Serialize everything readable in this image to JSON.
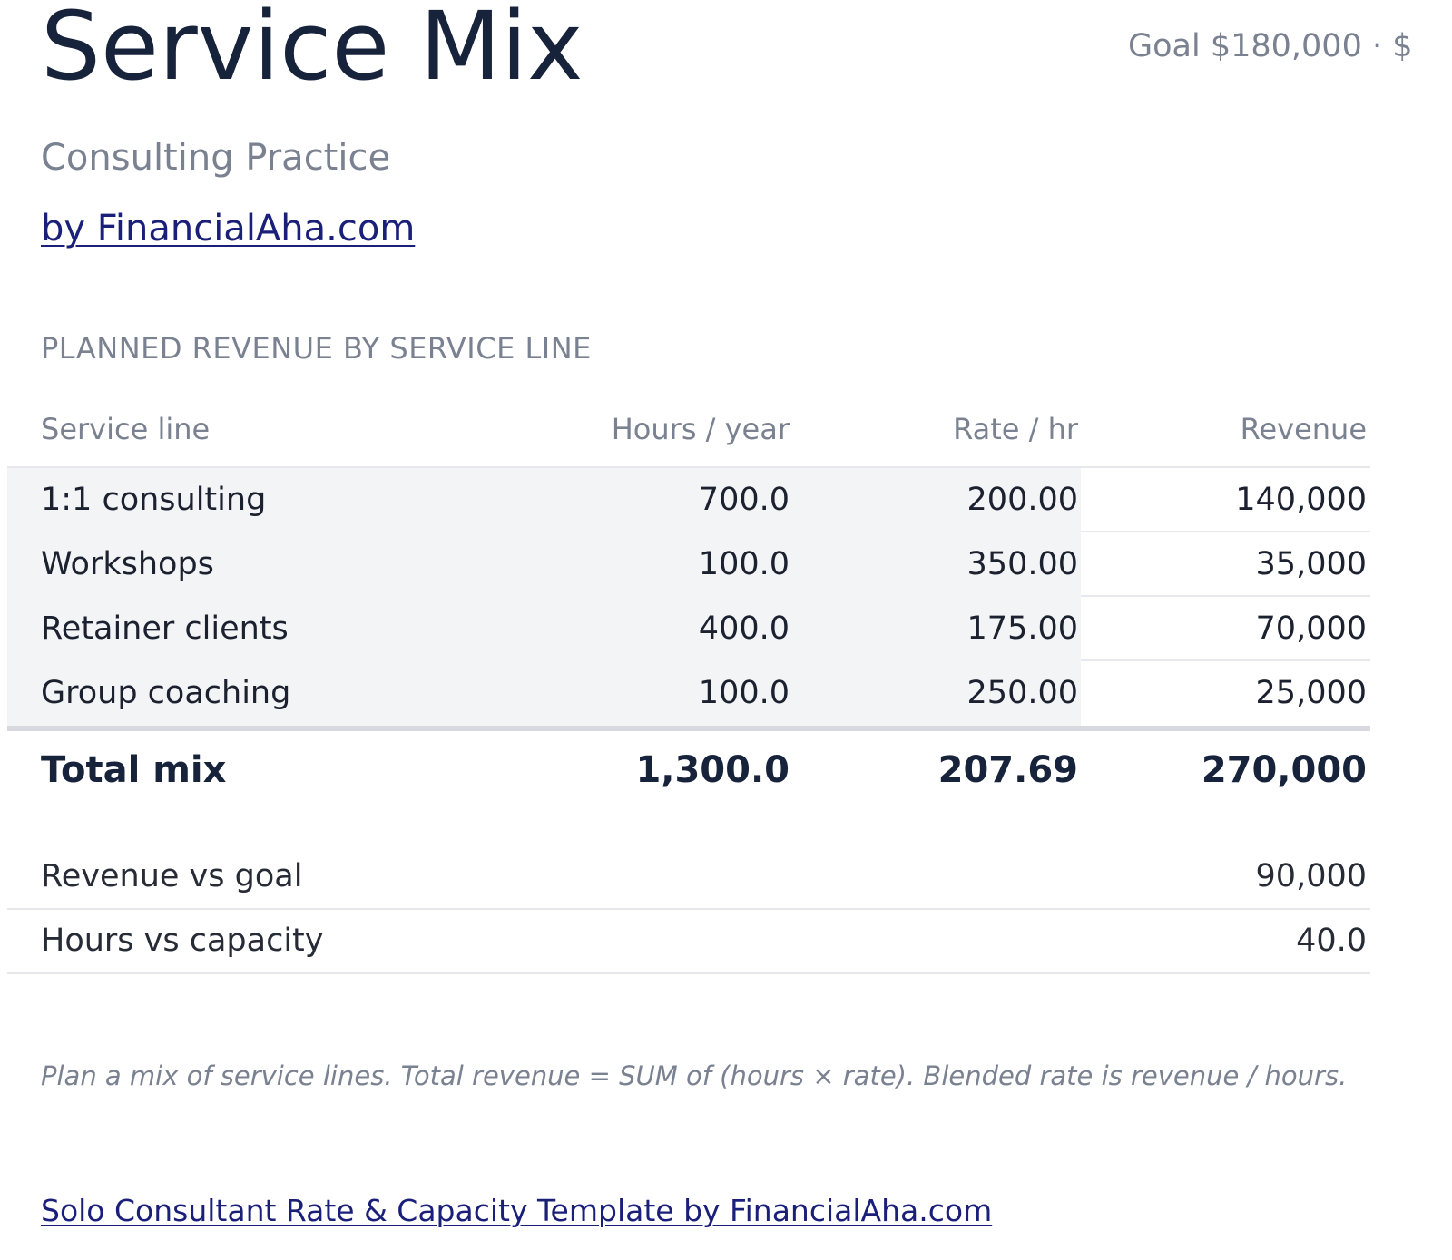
{
  "header": {
    "title": "Service Mix",
    "goal_summary": "Goal $180,000 · $",
    "subtitle": "Consulting Practice",
    "byline": "by FinancialAha.com"
  },
  "section_label": "PLANNED REVENUE BY SERVICE LINE",
  "table": {
    "columns": [
      "Service line",
      "Hours / year",
      "Rate / hr",
      "Revenue"
    ],
    "rows": [
      {
        "service": "1:1 consulting",
        "hours": "700.0",
        "rate": "200.00",
        "revenue": "140,000"
      },
      {
        "service": "Workshops",
        "hours": "100.0",
        "rate": "350.00",
        "revenue": "35,000"
      },
      {
        "service": "Retainer clients",
        "hours": "400.0",
        "rate": "175.00",
        "revenue": "70,000"
      },
      {
        "service": "Group coaching",
        "hours": "100.0",
        "rate": "250.00",
        "revenue": "25,000"
      }
    ],
    "total": {
      "label": "Total mix",
      "hours": "1,300.0",
      "rate": "207.69",
      "revenue": "270,000"
    }
  },
  "comparisons": [
    {
      "label": "Revenue vs goal",
      "value": "90,000"
    },
    {
      "label": "Hours vs capacity",
      "value": "40.0"
    }
  ],
  "footnote": "Plan a mix of service lines. Total revenue = SUM of (hours × rate). Blended rate is revenue / hours.",
  "footer_link": "Solo Consultant Rate & Capacity Template by FinancialAha.com"
}
